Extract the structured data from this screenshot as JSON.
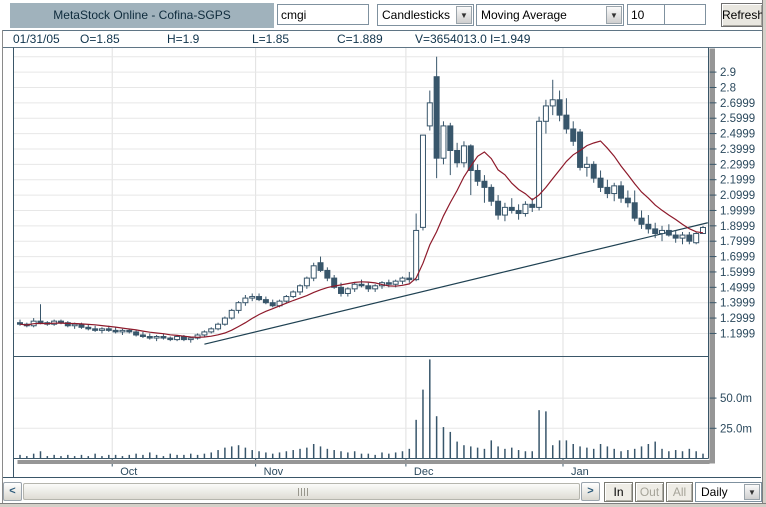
{
  "window": {
    "title": "MetaStock Online - Cofina-SGPS"
  },
  "toolbar": {
    "symbol_input": "cmgi",
    "chart_type_select": "Candlesticks",
    "indicator_select": "Moving Average",
    "period_input": "10",
    "param2_input": "",
    "refresh_label": "Refresh",
    "dropdown_arrow": "▼"
  },
  "quote_bar": {
    "date": "01/31/05",
    "open": "O=1.85",
    "high": "H=1.9",
    "low": "L=1.85",
    "close": "C=1.889",
    "volume": "V=3654013.0",
    "indicator": "I=1.949"
  },
  "bottom_bar": {
    "scroll_left": "<",
    "scroll_right": ">",
    "in_label": "In",
    "out_label": "Out",
    "all_label": "All",
    "timeframe_select": "Daily"
  },
  "chart_data": {
    "type": "candlestick+volume",
    "title": "Cofina-SGPS daily candlesticks with 10-period moving average and trendline",
    "legend_position": "none",
    "grid": true,
    "price_axis_range": [
      1.05,
      3.06
    ],
    "volume_axis_range": [
      0,
      84
    ],
    "price_gridline_values": [
      3.0,
      2.9,
      2.8,
      2.7,
      2.6,
      2.5,
      2.4,
      2.3,
      2.2,
      2.1,
      2.0,
      1.9,
      1.8,
      1.7,
      1.6,
      1.5,
      1.4,
      1.3,
      1.2
    ],
    "price_axis_labels": [
      {
        "label": "2.9",
        "value": 2.9
      },
      {
        "label": "2.8",
        "value": 2.8
      },
      {
        "label": "2.6999",
        "value": 2.7
      },
      {
        "label": "2.5999",
        "value": 2.6
      },
      {
        "label": "2.4999",
        "value": 2.5
      },
      {
        "label": "2.3999",
        "value": 2.4
      },
      {
        "label": "2.2999",
        "value": 2.3
      },
      {
        "label": "2.1999",
        "value": 2.2
      },
      {
        "label": "2.0999",
        "value": 2.1
      },
      {
        "label": "1.9999",
        "value": 2.0
      },
      {
        "label": "1.8999",
        "value": 1.9
      },
      {
        "label": "1.7999",
        "value": 1.8
      },
      {
        "label": "1.6999",
        "value": 1.7
      },
      {
        "label": "1.5999",
        "value": 1.6
      },
      {
        "label": "1.4999",
        "value": 1.5
      },
      {
        "label": "1.3999",
        "value": 1.4
      },
      {
        "label": "1.2999",
        "value": 1.3
      },
      {
        "label": "1.1999",
        "value": 1.2
      }
    ],
    "volume_axis_labels": [
      {
        "label": "50.0m",
        "value": 50
      },
      {
        "label": "25.0m",
        "value": 25
      }
    ],
    "months": [
      {
        "label": "Oct",
        "boundary_index": 14
      },
      {
        "label": "Nov",
        "boundary_index": 35
      },
      {
        "label": "Dec",
        "boundary_index": 57
      },
      {
        "label": "Jan",
        "boundary_index": 80
      }
    ],
    "moving_average_period": 10,
    "trendline": {
      "start_index": 27,
      "start_price": 1.13,
      "end_index": 100.7,
      "end_price": 1.92
    },
    "candles_ohlc": [
      [
        1.27,
        1.29,
        1.25,
        1.26
      ],
      [
        1.26,
        1.27,
        1.24,
        1.25
      ],
      [
        1.25,
        1.3,
        1.24,
        1.28
      ],
      [
        1.28,
        1.39,
        1.26,
        1.27
      ],
      [
        1.27,
        1.28,
        1.25,
        1.26
      ],
      [
        1.26,
        1.29,
        1.25,
        1.28
      ],
      [
        1.28,
        1.29,
        1.26,
        1.27
      ],
      [
        1.27,
        1.28,
        1.24,
        1.25
      ],
      [
        1.25,
        1.27,
        1.23,
        1.26
      ],
      [
        1.26,
        1.27,
        1.23,
        1.24
      ],
      [
        1.24,
        1.26,
        1.22,
        1.23
      ],
      [
        1.23,
        1.25,
        1.21,
        1.22
      ],
      [
        1.22,
        1.24,
        1.2,
        1.23
      ],
      [
        1.23,
        1.25,
        1.21,
        1.22
      ],
      [
        1.22,
        1.24,
        1.2,
        1.21
      ],
      [
        1.21,
        1.23,
        1.19,
        1.22
      ],
      [
        1.22,
        1.23,
        1.2,
        1.21
      ],
      [
        1.21,
        1.22,
        1.18,
        1.19
      ],
      [
        1.19,
        1.21,
        1.17,
        1.18
      ],
      [
        1.18,
        1.2,
        1.16,
        1.17
      ],
      [
        1.17,
        1.19,
        1.15,
        1.18
      ],
      [
        1.18,
        1.2,
        1.16,
        1.17
      ],
      [
        1.17,
        1.18,
        1.15,
        1.16
      ],
      [
        1.16,
        1.19,
        1.15,
        1.18
      ],
      [
        1.18,
        1.19,
        1.15,
        1.16
      ],
      [
        1.16,
        1.18,
        1.14,
        1.17
      ],
      [
        1.17,
        1.2,
        1.16,
        1.19
      ],
      [
        1.19,
        1.22,
        1.18,
        1.21
      ],
      [
        1.21,
        1.24,
        1.2,
        1.23
      ],
      [
        1.23,
        1.27,
        1.22,
        1.26
      ],
      [
        1.26,
        1.31,
        1.25,
        1.3
      ],
      [
        1.3,
        1.36,
        1.29,
        1.35
      ],
      [
        1.35,
        1.41,
        1.33,
        1.4
      ],
      [
        1.4,
        1.45,
        1.38,
        1.43
      ],
      [
        1.43,
        1.46,
        1.41,
        1.44
      ],
      [
        1.44,
        1.46,
        1.41,
        1.42
      ],
      [
        1.42,
        1.44,
        1.39,
        1.4
      ],
      [
        1.4,
        1.42,
        1.37,
        1.38
      ],
      [
        1.38,
        1.42,
        1.37,
        1.41
      ],
      [
        1.41,
        1.45,
        1.4,
        1.44
      ],
      [
        1.44,
        1.48,
        1.43,
        1.47
      ],
      [
        1.47,
        1.52,
        1.45,
        1.51
      ],
      [
        1.51,
        1.57,
        1.49,
        1.56
      ],
      [
        1.56,
        1.66,
        1.54,
        1.64
      ],
      [
        1.66,
        1.7,
        1.6,
        1.61
      ],
      [
        1.61,
        1.63,
        1.54,
        1.56
      ],
      [
        1.56,
        1.58,
        1.49,
        1.5
      ],
      [
        1.5,
        1.53,
        1.44,
        1.46
      ],
      [
        1.46,
        1.5,
        1.44,
        1.49
      ],
      [
        1.49,
        1.53,
        1.47,
        1.52
      ],
      [
        1.52,
        1.55,
        1.5,
        1.51
      ],
      [
        1.51,
        1.53,
        1.47,
        1.49
      ],
      [
        1.49,
        1.52,
        1.47,
        1.51
      ],
      [
        1.51,
        1.54,
        1.49,
        1.53
      ],
      [
        1.53,
        1.55,
        1.5,
        1.52
      ],
      [
        1.52,
        1.55,
        1.5,
        1.54
      ],
      [
        1.54,
        1.57,
        1.52,
        1.56
      ],
      [
        1.56,
        1.6,
        1.53,
        1.55
      ],
      [
        1.55,
        1.98,
        1.54,
        1.87
      ],
      [
        1.89,
        2.49,
        1.87,
        2.49
      ],
      [
        2.55,
        2.78,
        2.52,
        2.7
      ],
      [
        2.87,
        3.0,
        2.21,
        2.34
      ],
      [
        2.34,
        2.58,
        2.3,
        2.55
      ],
      [
        2.55,
        2.57,
        2.23,
        2.39
      ],
      [
        2.39,
        2.44,
        2.28,
        2.31
      ],
      [
        2.31,
        2.45,
        2.28,
        2.42
      ],
      [
        2.42,
        2.43,
        2.1,
        2.26
      ],
      [
        2.26,
        2.3,
        2.16,
        2.19
      ],
      [
        2.19,
        2.23,
        2.05,
        2.15
      ],
      [
        2.15,
        2.17,
        2.03,
        2.06
      ],
      [
        2.06,
        2.1,
        1.94,
        1.97
      ],
      [
        1.97,
        2.05,
        1.93,
        2.02
      ],
      [
        2.02,
        2.08,
        1.98,
        2.0
      ],
      [
        2.0,
        2.04,
        1.94,
        1.98
      ],
      [
        1.98,
        2.06,
        1.96,
        2.04
      ],
      [
        2.04,
        2.08,
        1.99,
        2.02
      ],
      [
        2.02,
        2.61,
        2.0,
        2.58
      ],
      [
        2.58,
        2.72,
        2.5,
        2.68
      ],
      [
        2.68,
        2.85,
        2.62,
        2.72
      ],
      [
        2.72,
        2.78,
        2.58,
        2.62
      ],
      [
        2.62,
        2.73,
        2.5,
        2.53
      ],
      [
        2.53,
        2.58,
        2.42,
        2.45
      ],
      [
        2.51,
        2.53,
        2.26,
        2.28
      ],
      [
        2.28,
        2.35,
        2.22,
        2.3
      ],
      [
        2.3,
        2.32,
        2.18,
        2.21
      ],
      [
        2.21,
        2.26,
        2.12,
        2.15
      ],
      [
        2.15,
        2.2,
        2.08,
        2.11
      ],
      [
        2.11,
        2.18,
        2.06,
        2.16
      ],
      [
        2.16,
        2.19,
        2.05,
        2.08
      ],
      [
        2.08,
        2.13,
        2.02,
        2.05
      ],
      [
        2.05,
        2.13,
        1.93,
        1.95
      ],
      [
        1.95,
        2.0,
        1.88,
        1.91
      ],
      [
        1.91,
        1.97,
        1.85,
        1.88
      ],
      [
        1.88,
        1.92,
        1.82,
        1.85
      ],
      [
        1.85,
        1.9,
        1.8,
        1.87
      ],
      [
        1.87,
        1.91,
        1.83,
        1.84
      ],
      [
        1.84,
        1.87,
        1.79,
        1.82
      ],
      [
        1.82,
        1.86,
        1.78,
        1.84
      ],
      [
        1.84,
        1.86,
        1.78,
        1.8
      ],
      [
        1.79,
        1.86,
        1.78,
        1.85
      ],
      [
        1.85,
        1.9,
        1.85,
        1.889
      ]
    ],
    "volumes_millions": [
      3,
      2,
      4,
      6,
      2,
      3,
      2,
      3,
      2,
      3,
      2,
      4,
      2,
      3,
      3,
      2,
      3,
      4,
      3,
      5,
      3,
      2,
      4,
      3,
      3,
      4,
      3,
      4,
      5,
      7,
      9,
      10,
      11,
      9,
      7,
      6,
      5,
      4,
      5,
      6,
      7,
      8,
      9,
      12,
      10,
      8,
      7,
      6,
      5,
      6,
      4,
      4,
      3,
      5,
      4,
      5,
      6,
      8,
      32,
      57,
      82,
      35,
      26,
      22,
      14,
      11,
      10,
      9,
      8,
      15,
      10,
      8,
      9,
      7,
      6,
      6,
      40,
      39,
      11,
      15,
      15,
      12,
      10,
      9,
      8,
      12,
      10,
      8,
      6,
      7,
      8,
      10,
      12,
      14,
      8,
      6,
      7,
      6,
      8,
      6,
      4
    ],
    "colors": {
      "candle": "#38566B",
      "candle_hollow_fill": "#FFFFFF",
      "ma_line": "#8E1A2B",
      "trendline": "#1F4152",
      "grid": "#E7E7E7",
      "month_grid": "#E0E0E0",
      "axis_text": "#2C4A5E",
      "pane_border": "#3A5668",
      "shadow_band": "#969696"
    }
  }
}
